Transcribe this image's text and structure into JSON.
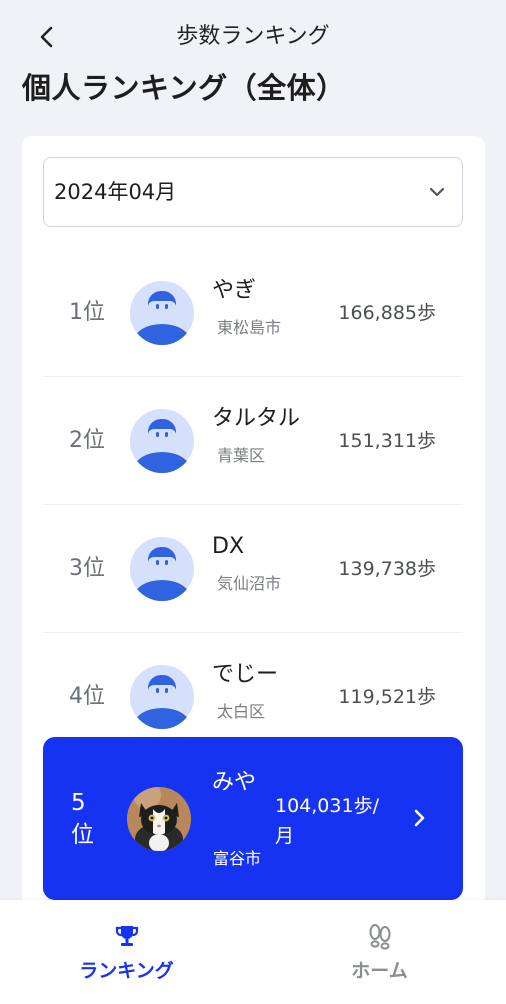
{
  "header": {
    "title": "歩数ランキング",
    "back_icon": "chevron-left-icon"
  },
  "page_title": "個人ランキング（全体）",
  "month_select": {
    "value": "2024年04月",
    "icon": "chevron-down-icon"
  },
  "rankings": [
    {
      "rank": "1位",
      "name": "やぎ",
      "city": "東松島市",
      "steps": "166,885歩"
    },
    {
      "rank": "2位",
      "name": "タルタル",
      "city": "青葉区",
      "steps": "151,311歩"
    },
    {
      "rank": "3位",
      "name": "DX",
      "city": "気仙沼市",
      "steps": "139,738歩"
    },
    {
      "rank": "4位",
      "name": "でじー",
      "city": "太白区",
      "steps": "119,521歩"
    }
  ],
  "self": {
    "rank": "5位",
    "name": "みや",
    "city": "富谷市",
    "steps": "104,031歩/月",
    "icon": "chevron-right-icon"
  },
  "tabs": [
    {
      "label": "ランキング",
      "icon": "trophy-icon",
      "active": true
    },
    {
      "label": "ホーム",
      "icon": "footprints-icon",
      "active": false
    }
  ],
  "colors": {
    "accent": "#1733f2",
    "background": "#f1f2f6",
    "avatar_bg": "#d5e0fb",
    "avatar_fg": "#2f63e0"
  }
}
